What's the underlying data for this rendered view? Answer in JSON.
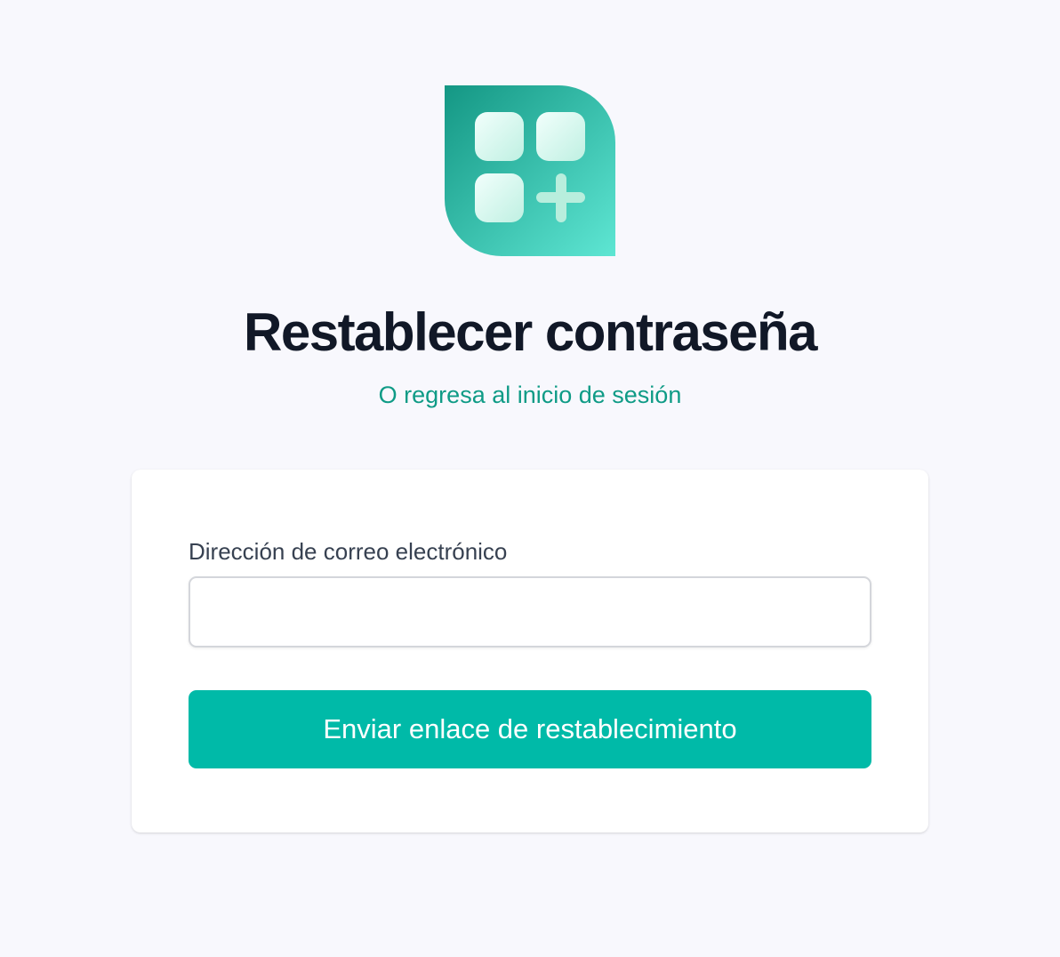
{
  "brand": {
    "logo_icon": "apps-add-icon",
    "gradient_start": "#149784",
    "gradient_end": "#5ee6d3"
  },
  "header": {
    "title": "Restablecer contraseña",
    "back_link": "O regresa al inicio de sesión"
  },
  "form": {
    "email_label": "Dirección de correo electrónico",
    "email_value": "",
    "email_placeholder": "",
    "submit_label": "Enviar enlace de restablecimiento"
  },
  "colors": {
    "accent": "#00baa8",
    "link": "#0f9b86",
    "title": "#111827",
    "background": "#f8f8fd"
  }
}
